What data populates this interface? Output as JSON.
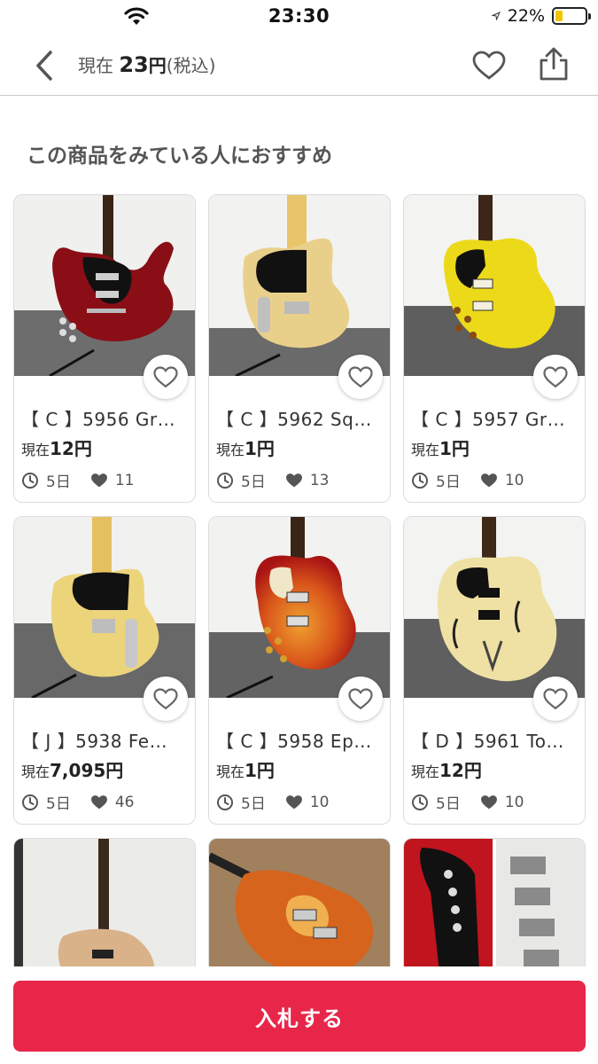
{
  "status_bar": {
    "time": "23:30",
    "battery_pct": "22%",
    "battery_level": 0.22
  },
  "header": {
    "price_label": "現在",
    "price_value": "23",
    "price_unit": "円",
    "tax_note": "(税込)"
  },
  "section_title": "この商品をみている人におすすめ",
  "items": [
    {
      "title": "【 C 】5956 Gr…",
      "price_label": "現在",
      "price": "12円",
      "days": "5日",
      "likes": "11"
    },
    {
      "title": "【 C 】5962 Sq…",
      "price_label": "現在",
      "price": "1円",
      "days": "5日",
      "likes": "13"
    },
    {
      "title": "【 C 】5957 Gr…",
      "price_label": "現在",
      "price": "1円",
      "days": "5日",
      "likes": "10"
    },
    {
      "title": "【 J 】5938 Fe…",
      "price_label": "現在",
      "price": "7,095円",
      "days": "5日",
      "likes": "46"
    },
    {
      "title": "【 C 】5958 Ep…",
      "price_label": "現在",
      "price": "1円",
      "days": "5日",
      "likes": "10"
    },
    {
      "title": "【 D 】5961 To…",
      "price_label": "現在",
      "price": "12円",
      "days": "5日",
      "likes": "10"
    }
  ],
  "bid_button": "入札する",
  "colors": {
    "accent": "#e8264a"
  }
}
